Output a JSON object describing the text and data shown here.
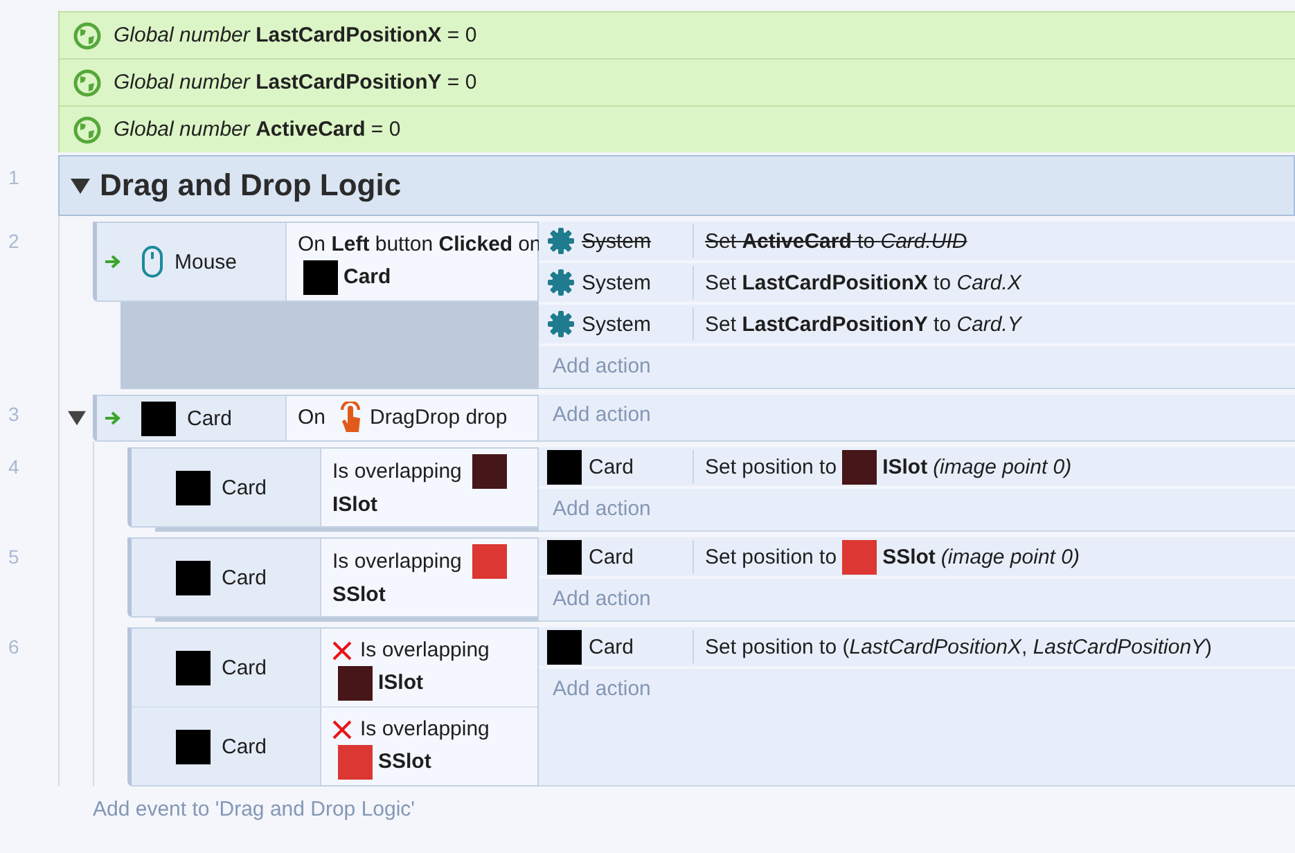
{
  "globals": [
    {
      "text": "*Global number* **LastCardPositionX** = 0"
    },
    {
      "text": "*Global number* **LastCardPositionY** = 0"
    },
    {
      "text": "*Global number* **ActiveCard** = 0"
    }
  ],
  "group": {
    "line": "1",
    "title": "Drag and Drop Logic",
    "expanded": true,
    "add_event": "Add event to 'Drag and Drop Logic'"
  },
  "events": [
    {
      "line": "2",
      "trigger": true,
      "conditions": [
        {
          "kind": "mouse",
          "object": "Mouse",
          "inverted": false,
          "parts": [
            {
              "kind": "text",
              "text": "On **Left** button **Clicked**"
            },
            {
              "kind": "text",
              "text": "on"
            },
            {
              "kind": "swatch",
              "color": "#000000"
            },
            {
              "kind": "name",
              "text": "Card"
            }
          ]
        }
      ],
      "actions": [
        {
          "kind": "system",
          "object": "System",
          "disabled": true,
          "parts": [
            {
              "kind": "text",
              "text": "Set **ActiveCard** to *Card.UID*"
            }
          ]
        },
        {
          "kind": "system",
          "object": "System",
          "disabled": false,
          "parts": [
            {
              "kind": "text",
              "text": "Set **LastCardPositionX** to *Card.X*"
            }
          ]
        },
        {
          "kind": "system",
          "object": "System",
          "disabled": false,
          "parts": [
            {
              "kind": "text",
              "text": "Set **LastCardPositionY** to *Card.Y*"
            }
          ]
        }
      ],
      "add_action": "Add action"
    },
    {
      "line": "3",
      "trigger": true,
      "expanded": true,
      "conditions": [
        {
          "kind": "sprite",
          "color": "#000000",
          "object": "Card",
          "inverted": false,
          "parts": [
            {
              "kind": "text",
              "text": "On"
            },
            {
              "kind": "behavior"
            },
            {
              "kind": "text",
              "text": "DragDrop drop"
            }
          ]
        }
      ],
      "add_action": "Add action",
      "children": [
        {
          "line": "4",
          "trigger": false,
          "conditions": [
            {
              "kind": "sprite",
              "color": "#000000",
              "object": "Card",
              "inverted": false,
              "parts": [
                {
                  "kind": "text",
                  "text": "Is overlapping"
                },
                {
                  "kind": "swatch",
                  "color": "#461619"
                },
                {
                  "kind": "name",
                  "text": "ISlot"
                }
              ]
            }
          ],
          "actions": [
            {
              "kind": "sprite",
              "color": "#000000",
              "object": "Card",
              "disabled": false,
              "parts": [
                {
                  "kind": "text",
                  "text": "Set position to"
                },
                {
                  "kind": "swatch",
                  "color": "#461619"
                },
                {
                  "kind": "name",
                  "text": "ISlot"
                },
                {
                  "kind": "param",
                  "text": "(image point 0)"
                }
              ]
            }
          ],
          "add_action": "Add action"
        },
        {
          "line": "5",
          "trigger": false,
          "conditions": [
            {
              "kind": "sprite",
              "color": "#000000",
              "object": "Card",
              "inverted": false,
              "parts": [
                {
                  "kind": "text",
                  "text": "Is overlapping"
                },
                {
                  "kind": "swatch",
                  "color": "#dc3732"
                },
                {
                  "kind": "name",
                  "text": "SSlot"
                }
              ]
            }
          ],
          "actions": [
            {
              "kind": "sprite",
              "color": "#000000",
              "object": "Card",
              "disabled": false,
              "parts": [
                {
                  "kind": "text",
                  "text": "Set position to"
                },
                {
                  "kind": "swatch",
                  "color": "#dc3732"
                },
                {
                  "kind": "name",
                  "text": "SSlot"
                },
                {
                  "kind": "param",
                  "text": "(image point 0)"
                }
              ]
            }
          ],
          "add_action": "Add action"
        },
        {
          "line": "6",
          "trigger": false,
          "conditions": [
            {
              "kind": "sprite",
              "color": "#000000",
              "object": "Card",
              "inverted": true,
              "parts": [
                {
                  "kind": "text",
                  "text": "Is overlapping"
                },
                {
                  "kind": "swatch",
                  "color": "#461619"
                },
                {
                  "kind": "name",
                  "text": "ISlot"
                }
              ]
            },
            {
              "kind": "sprite",
              "color": "#000000",
              "object": "Card",
              "inverted": true,
              "parts": [
                {
                  "kind": "text",
                  "text": "Is overlapping"
                },
                {
                  "kind": "swatch",
                  "color": "#dc3732"
                },
                {
                  "kind": "name",
                  "text": "SSlot"
                }
              ]
            }
          ],
          "actions": [
            {
              "kind": "sprite",
              "color": "#000000",
              "object": "Card",
              "disabled": false,
              "parts": [
                {
                  "kind": "text",
                  "text": "Set position to (*LastCardPositionX*, *LastCardPositionY*)"
                }
              ]
            }
          ],
          "add_action": "Add action"
        }
      ]
    }
  ]
}
